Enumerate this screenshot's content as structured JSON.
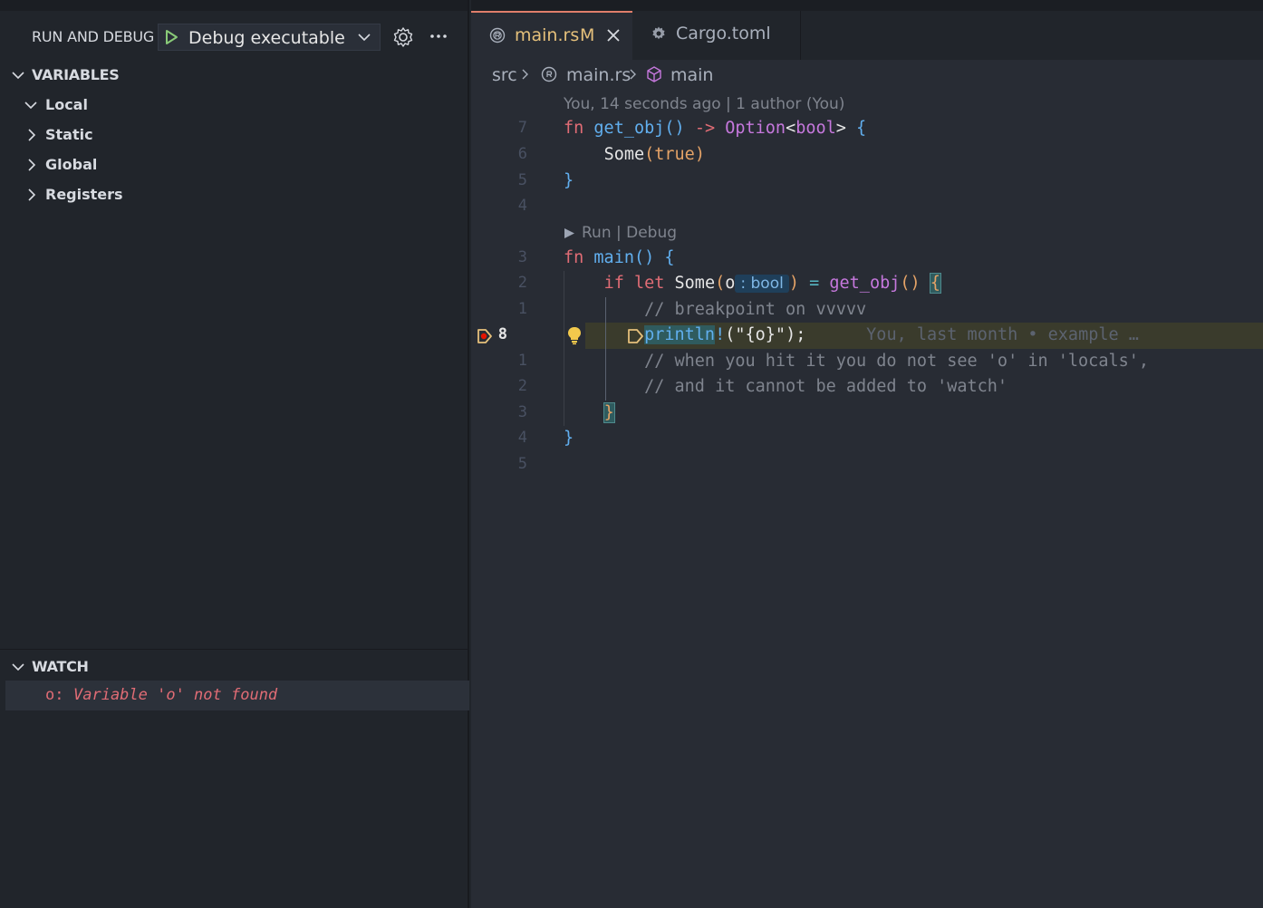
{
  "sidebar": {
    "title": "RUN AND DEBUG",
    "config_label": "Debug executable 'le",
    "sections": {
      "variables": "VARIABLES",
      "watch": "WATCH"
    },
    "variables": {
      "local": "Local",
      "static": "Static",
      "global": "Global",
      "registers": "Registers"
    },
    "watch_items": [
      {
        "expr": "o:",
        "error": "Variable 'o' not found"
      }
    ]
  },
  "tabs": [
    {
      "name": "main.rs",
      "modified": "M",
      "active": true
    },
    {
      "name": "Cargo.toml",
      "active": false
    }
  ],
  "breadcrumb": {
    "folder": "src",
    "file": "main.rs",
    "symbol": "main"
  },
  "codelens": {
    "blame": "You, 14 seconds ago | 1 author (You)",
    "run_debug": "Run | Debug"
  },
  "line_numbers": [
    "7",
    "6",
    "5",
    "4",
    "3",
    "2",
    "1",
    "8",
    "1",
    "2",
    "3",
    "4",
    "5"
  ],
  "code": {
    "l1": {
      "kw": "fn",
      "name": "get_obj",
      "rest1": "() ",
      "arrow": "->",
      "ty": "Option",
      "lt": "<",
      "ty2": "bool",
      "gt": ">",
      "brace": " {"
    },
    "l2": {
      "some": "Some",
      "p1": "(",
      "val": "true",
      "p2": ")"
    },
    "l3": {
      "brace": "}"
    },
    "l5": {
      "kw": "fn",
      "name": "main",
      "rest": "() {"
    },
    "l6": {
      "kw": "if let",
      "some": "Some",
      "p1": "(",
      "var": "o",
      "inlay": ": bool",
      "p2": ")",
      "eq": " = ",
      "call": "get_obj",
      "parens": "()",
      "brace": "{"
    },
    "l7": {
      "comment": "// breakpoint on vvvvv"
    },
    "l8": {
      "macro": "println",
      "bang": "!",
      "p1": "(",
      "str": "\"{o}\"",
      "p2": ");",
      "blame": "You, last month • example …"
    },
    "l9": {
      "comment": "// when you hit it you do not see 'o' in 'locals',"
    },
    "l10": {
      "comment": "// and it cannot be added to 'watch'"
    },
    "l11": {
      "brace": "}"
    },
    "l12": {
      "brace": "}"
    }
  },
  "colors": {
    "accent_tab": "#e07e6b",
    "breakpoint": "#e5c07b",
    "error_text": "#e06c75",
    "current_line": "#3a3b2c"
  }
}
